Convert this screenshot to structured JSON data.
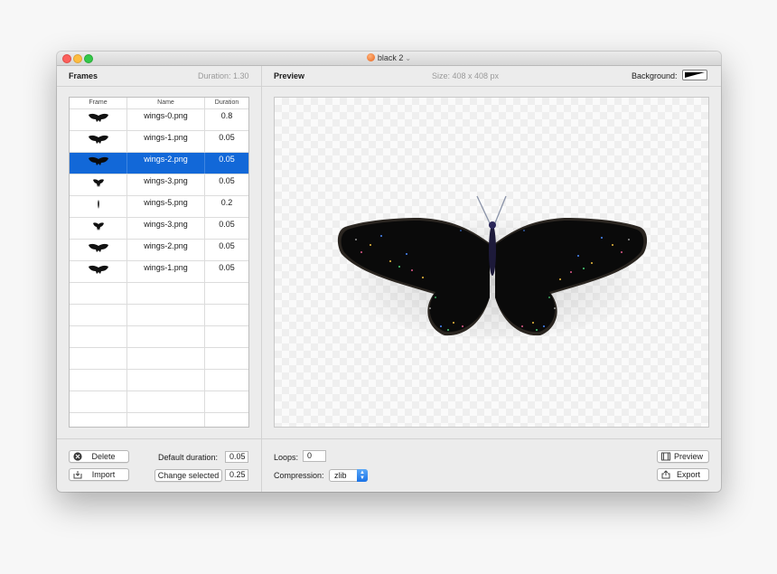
{
  "window": {
    "title": "black 2"
  },
  "frames_panel": {
    "title": "Frames",
    "total_duration": "Duration: 1.30",
    "columns": [
      "Frame",
      "Name",
      "Duration"
    ],
    "rows": [
      {
        "name": "wings-0.png",
        "duration": "0.8",
        "shape": "wide"
      },
      {
        "name": "wings-1.png",
        "duration": "0.05",
        "shape": "wide"
      },
      {
        "name": "wings-2.png",
        "duration": "0.05",
        "shape": "wide",
        "selected": true
      },
      {
        "name": "wings-3.png",
        "duration": "0.05",
        "shape": "half"
      },
      {
        "name": "wings-5.png",
        "duration": "0.2",
        "shape": "thin"
      },
      {
        "name": "wings-3.png",
        "duration": "0.05",
        "shape": "half"
      },
      {
        "name": "wings-2.png",
        "duration": "0.05",
        "shape": "wide"
      },
      {
        "name": "wings-1.png",
        "duration": "0.05",
        "shape": "wide"
      }
    ]
  },
  "preview_panel": {
    "title": "Preview",
    "size": "Size: 408 x 408 px",
    "background_label": "Background:"
  },
  "footer": {
    "delete_label": "Delete",
    "import_label": "Import",
    "default_duration_label": "Default duration:",
    "default_duration_value": "0.05",
    "change_selected_label": "Change selected",
    "change_selected_value": "0.25",
    "loops_label": "Loops:",
    "loops_value": "0",
    "compression_label": "Compression:",
    "compression_value": "zlib",
    "preview_button": "Preview",
    "export_button": "Export"
  },
  "colors": {
    "selection": "#1268d8",
    "stepper_accent": "#1a72e6",
    "butterfly_body": "#0a0a0a"
  },
  "icons": {
    "delete": "circle-x-icon",
    "import": "import-tray-icon",
    "preview": "preview-window-icon",
    "export": "share-export-icon"
  }
}
